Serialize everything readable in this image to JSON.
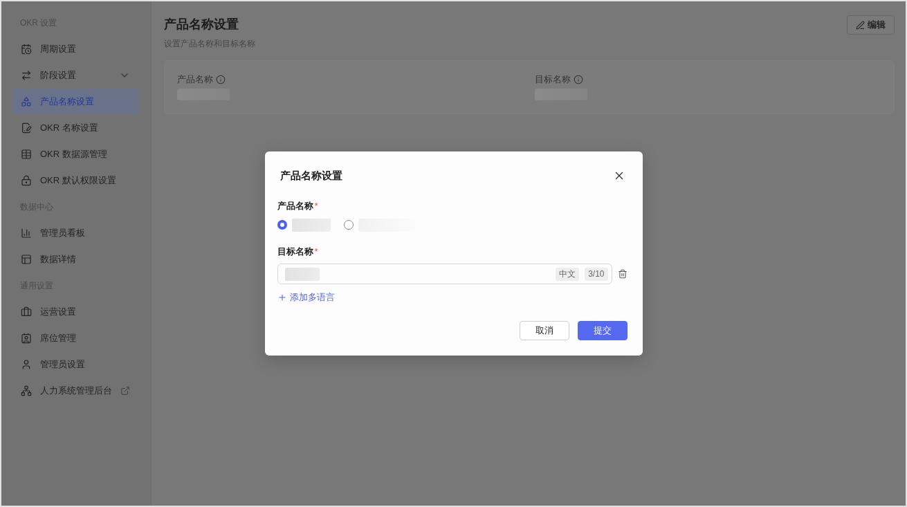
{
  "sidebar": {
    "sections": [
      {
        "heading": "OKR 设置",
        "items": [
          {
            "label": "周期设置",
            "kind": "page",
            "selected": false
          },
          {
            "label": "阶段设置",
            "kind": "group",
            "expanded": false,
            "selected": false
          },
          {
            "label": "产品名称设置",
            "kind": "page",
            "selected": true
          },
          {
            "label": "OKR 名称设置",
            "kind": "page",
            "selected": false
          },
          {
            "label": "OKR 数据源管理",
            "kind": "page",
            "selected": false
          },
          {
            "label": "OKR 默认权限设置",
            "kind": "page",
            "selected": false
          }
        ]
      },
      {
        "heading": "数据中心",
        "items": [
          {
            "label": "管理员看板",
            "kind": "page",
            "selected": false
          },
          {
            "label": "数据详情",
            "kind": "page",
            "selected": false
          }
        ]
      },
      {
        "heading": "通用设置",
        "items": [
          {
            "label": "运营设置",
            "kind": "page",
            "selected": false
          },
          {
            "label": "席位管理",
            "kind": "page",
            "selected": false
          },
          {
            "label": "管理员设置",
            "kind": "page",
            "selected": false
          },
          {
            "label": "人力系统管理后台",
            "kind": "external",
            "selected": false
          }
        ]
      }
    ]
  },
  "page": {
    "title": "产品名称设置",
    "subtitle": "设置产品名称和目标名称",
    "edit_button": "编辑",
    "fields": [
      {
        "label": "产品名称"
      },
      {
        "label": "目标名称"
      }
    ]
  },
  "dialog": {
    "title": "产品名称设置",
    "product_name": {
      "label": "产品名称",
      "required_mark": "*",
      "options": [
        {
          "selected": true
        },
        {
          "selected": false
        }
      ]
    },
    "target_name": {
      "label": "目标名称",
      "required_mark": "*",
      "language_tag": "中文",
      "counter": "3/10"
    },
    "add_language": "添加多语言",
    "buttons": [
      {
        "label": "取消",
        "kind": "secondary"
      },
      {
        "label": "提交",
        "kind": "primary"
      }
    ]
  }
}
